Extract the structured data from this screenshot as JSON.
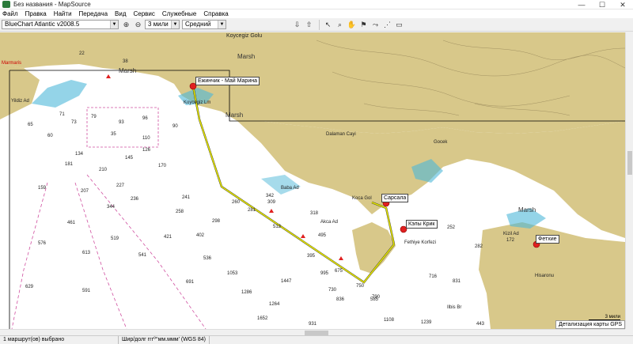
{
  "window": {
    "title": "Без названия - MapSource",
    "min": "—",
    "max": "☐",
    "close": "✕"
  },
  "menu": [
    "Файл",
    "Правка",
    "Найти",
    "Передача",
    "Вид",
    "Сервис",
    "Служебные",
    "Справка"
  ],
  "toolbar": {
    "map_product": "BlueChart Atlantic v2008.5",
    "zoom_scale": "3 мили",
    "detail_level": "Средний"
  },
  "map": {
    "route_labels": [
      {
        "name": "Ежинчик - Май Марина"
      },
      {
        "name": "Сарсала"
      },
      {
        "name": "Кэлы Крик"
      },
      {
        "name": "Фетхие"
      }
    ],
    "place_names": {
      "marsh": "Marsh",
      "koycegiz": "Koycegiz Golu",
      "koycegiz_lm": "Koycegiz Lm",
      "dalaman": "Dalaman Cayi",
      "gocek": "Gocek",
      "bava": "Baba Ad",
      "kocagol": "Koca Gol",
      "akca": "Akca Ad",
      "fethiye_korfezi": "Fethiye Korfezi",
      "kizil": "Kizil Ad",
      "yildiz": "Yildiz Ad",
      "hisaronu": "Hisaronu",
      "ilbis": "Ilbis Br",
      "marmaris": "Marmaris"
    },
    "depths": [
      "38",
      "22",
      "35",
      "60",
      "90",
      "73",
      "65",
      "71",
      "79",
      "110",
      "93",
      "96",
      "126",
      "134",
      "145",
      "159",
      "170",
      "181",
      "207",
      "210",
      "227",
      "241",
      "236",
      "258",
      "260",
      "281",
      "298",
      "309",
      "318",
      "342",
      "344",
      "395",
      "402",
      "421",
      "461",
      "495",
      "513",
      "519",
      "536",
      "541",
      "576",
      "585",
      "591",
      "613",
      "629",
      "675",
      "691",
      "716",
      "730",
      "750",
      "790",
      "831",
      "836",
      "931",
      "995",
      "1053",
      "1108",
      "1239",
      "1264",
      "1286",
      "1447",
      "1652",
      "443",
      "252",
      "282",
      "172"
    ],
    "scale_label": "3 мили",
    "detail_label": "Детализация карты GPS"
  },
  "status": {
    "selection": "1 маршрут(ов) выбрано",
    "coord_format": "Шир/долг гггº°мм.ммм' (WGS 84)"
  },
  "colors": {
    "land": "#d8c88a",
    "water": "#ffffff",
    "shallow": "#4db8d8",
    "route": "#e6e600",
    "waypoint": "#e02020"
  }
}
